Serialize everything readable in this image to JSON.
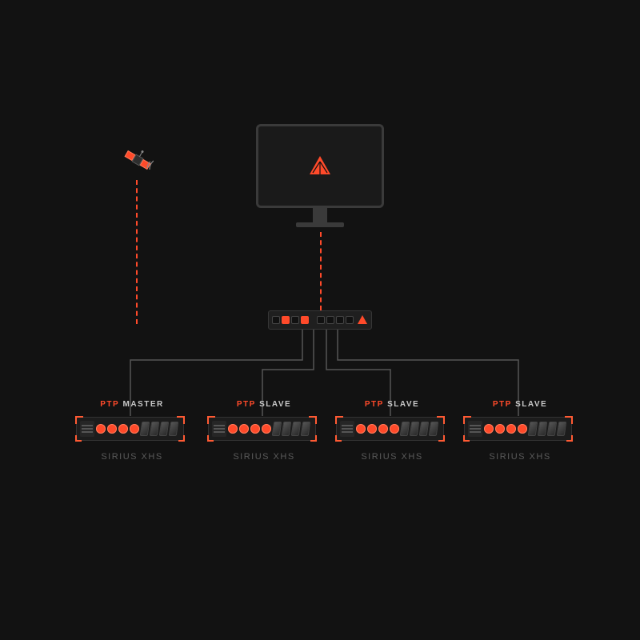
{
  "accent": "#ff4a2a",
  "monitor": {
    "logo": "triangle-logo"
  },
  "switch": {
    "logo": "triangle-logo"
  },
  "devices": [
    {
      "ptp": "PTP",
      "role": "MASTER",
      "model": "SIRIUS XHS"
    },
    {
      "ptp": "PTP",
      "role": "SLAVE",
      "model": "SIRIUS XHS"
    },
    {
      "ptp": "PTP",
      "role": "SLAVE",
      "model": "SIRIUS XHS"
    },
    {
      "ptp": "PTP",
      "role": "SLAVE",
      "model": "SIRIUS XHS"
    }
  ]
}
